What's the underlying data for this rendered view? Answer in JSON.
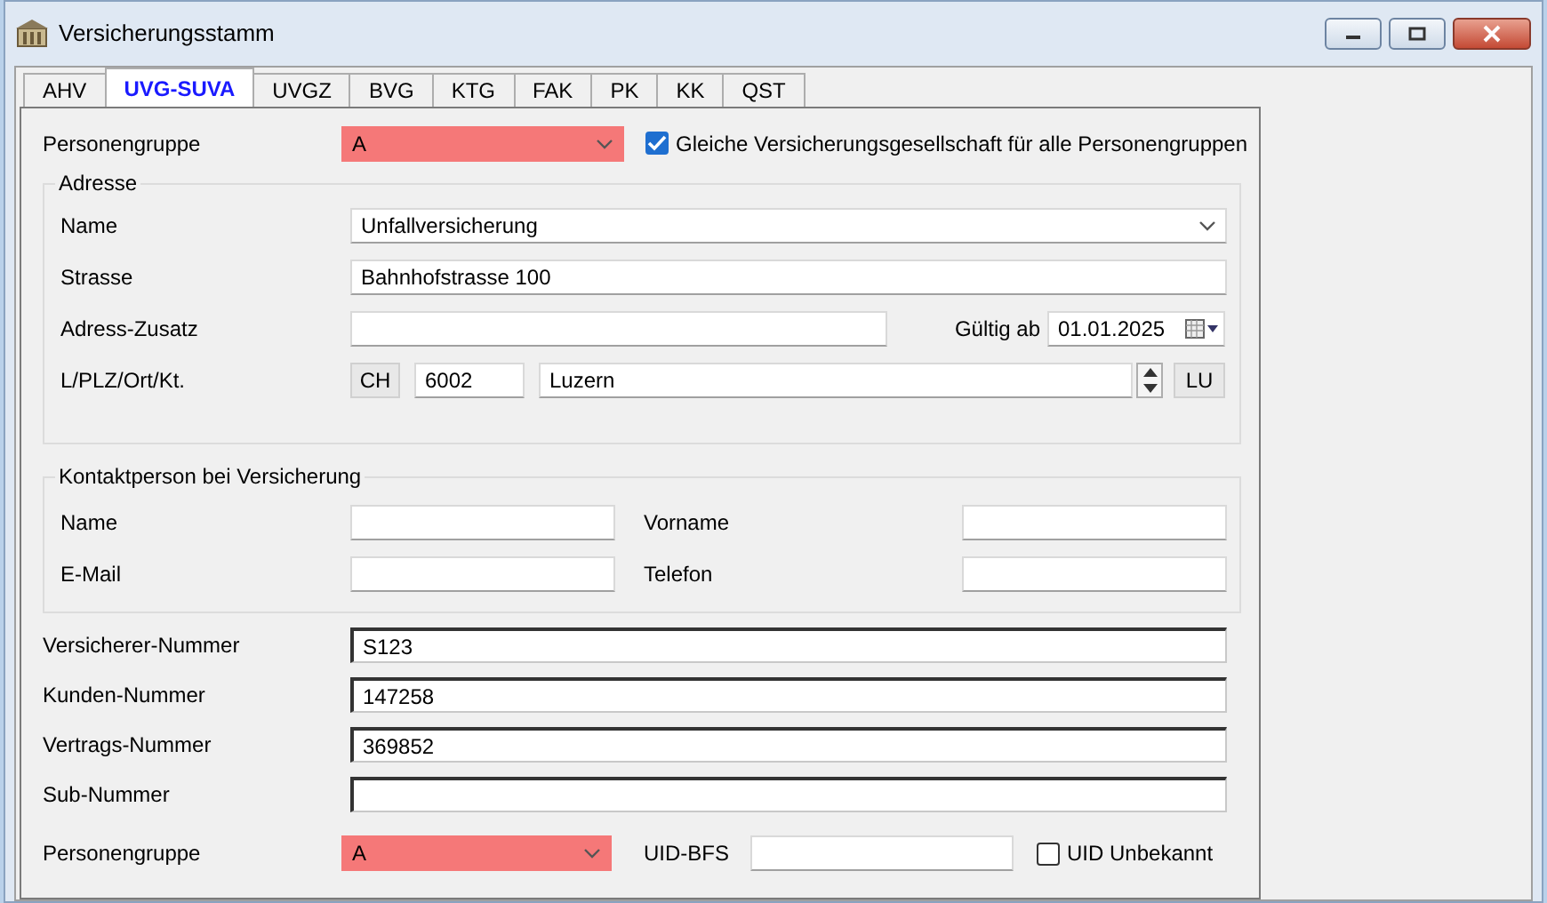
{
  "window": {
    "title": "Versicherungsstamm"
  },
  "tabs": [
    {
      "label": "AHV",
      "selected": false
    },
    {
      "label": "UVG-SUVA",
      "selected": true
    },
    {
      "label": "UVGZ",
      "selected": false
    },
    {
      "label": "BVG",
      "selected": false
    },
    {
      "label": "KTG",
      "selected": false
    },
    {
      "label": "FAK",
      "selected": false
    },
    {
      "label": "PK",
      "selected": false
    },
    {
      "label": "KK",
      "selected": false
    },
    {
      "label": "QST",
      "selected": false
    }
  ],
  "top": {
    "label": "Personengruppe",
    "value": "A",
    "highlighted": true,
    "checkbox": {
      "label": "Gleiche Versicherungsgesellschaft für alle Personengruppen",
      "checked": true
    }
  },
  "address": {
    "legend": "Adresse",
    "name": {
      "label": "Name",
      "value": "Unfallversicherung"
    },
    "street": {
      "label": "Strasse",
      "value": "Bahnhofstrasse 100"
    },
    "extra": {
      "label": "Adress-Zusatz"
    },
    "valid_from": {
      "label": "Gültig ab",
      "value": "01.01.2025"
    },
    "location": {
      "label": "L/PLZ/Ort/Kt.",
      "country": "CH",
      "zip": "6002",
      "city": "Luzern",
      "canton": "LU"
    }
  },
  "contact": {
    "legend": "Kontaktperson bei Versicherung",
    "fields": [
      {
        "label": "Name"
      },
      {
        "label": "Vorname"
      },
      {
        "label": "E-Mail"
      },
      {
        "label": "Telefon"
      }
    ]
  },
  "numbers": [
    {
      "label": "Versicherer-Nummer",
      "value": "S123"
    },
    {
      "label": "Kunden-Nummer",
      "value": "147258"
    },
    {
      "label": "Vertrags-Nummer",
      "value": "369852"
    },
    {
      "label": "Sub-Nummer"
    }
  ],
  "bottom": {
    "label": "Personengruppe",
    "value": "A",
    "highlighted": true,
    "uid_label": "UID-BFS",
    "checkbox": {
      "label": "UID Unbekannt",
      "checked": false
    }
  }
}
